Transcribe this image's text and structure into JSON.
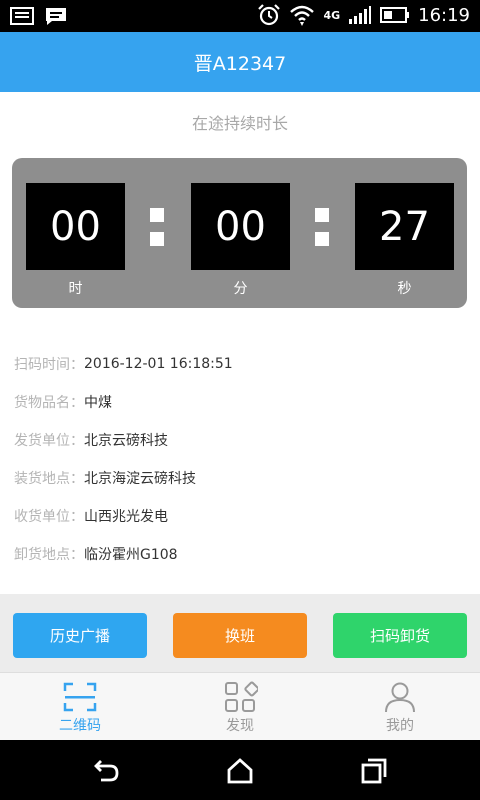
{
  "status_bar": {
    "time": "16:19",
    "network": "4G"
  },
  "header": {
    "title": "晋A12347"
  },
  "subtitle": "在途持续时长",
  "timer": {
    "hours": "00",
    "minutes": "00",
    "seconds": "27",
    "hours_label": "时",
    "minutes_label": "分",
    "seconds_label": "秒"
  },
  "info": [
    {
      "key": "扫码时间：",
      "value": "2016-12-01 16:18:51"
    },
    {
      "key": "货物品名：",
      "value": "中煤"
    },
    {
      "key": "发货单位：",
      "value": "北京云磅科技"
    },
    {
      "key": "装货地点：",
      "value": "北京海淀云磅科技"
    },
    {
      "key": "收货单位：",
      "value": "山西兆光发电"
    },
    {
      "key": "卸货地点：",
      "value": "临汾霍州G108"
    }
  ],
  "actions": {
    "history": "历史广播",
    "shift": "换班",
    "scan_unload": "扫码卸货"
  },
  "tabs": [
    {
      "label": "二维码",
      "icon": "qr-scan-icon"
    },
    {
      "label": "发现",
      "icon": "discover-icon"
    },
    {
      "label": "我的",
      "icon": "profile-icon"
    }
  ],
  "colors": {
    "primary": "#36a3ef",
    "history_button": "#2fa6f0",
    "shift_button": "#f58b1f",
    "scan_button": "#2fd46b"
  }
}
